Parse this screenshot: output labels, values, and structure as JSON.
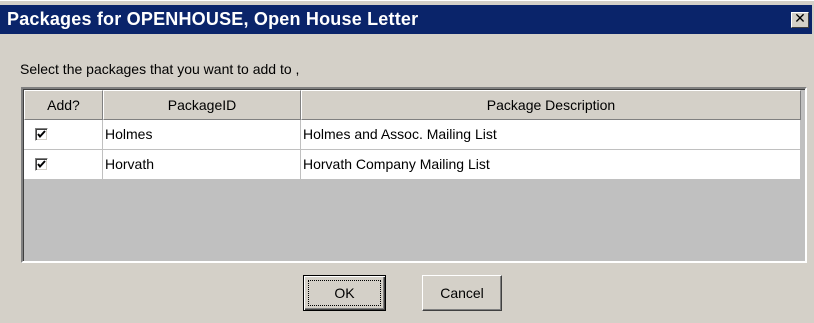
{
  "window": {
    "title": "Packages for OPENHOUSE, Open House Letter",
    "close_glyph": "✕"
  },
  "prompt": "Select the packages that you want to add to ,",
  "grid": {
    "columns": [
      "Add?",
      "PackageID",
      "Package Description"
    ],
    "rows": [
      {
        "add": true,
        "package_id": "Holmes",
        "description": "Holmes and Assoc. Mailing List"
      },
      {
        "add": true,
        "package_id": "Horvath",
        "description": "Horvath Company Mailing List"
      }
    ]
  },
  "buttons": {
    "ok_label": "OK",
    "cancel_label": "Cancel"
  },
  "colors": {
    "title_bar": "#0a246a",
    "dialog_face": "#d4d0c8",
    "grid_background": "#c0c0c0"
  }
}
